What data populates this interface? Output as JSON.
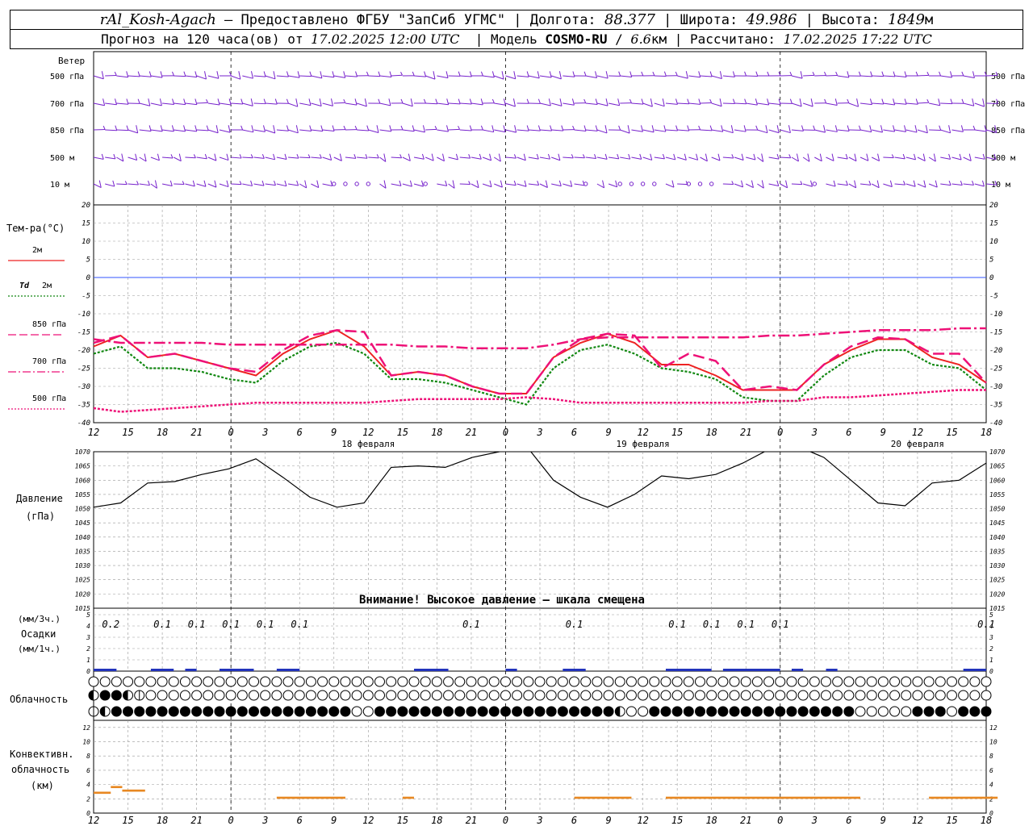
{
  "header": {
    "station": "rAl_Kosh-Agach",
    "sep": "–",
    "provider": "Предоставлено ФГБУ \"ЗапСиб УГМС\"",
    "lon_label": "Долгота:",
    "lon_value": "88.377",
    "lat_label": "Широта:",
    "lat_value": "49.986",
    "alt_label": "Высота:",
    "alt_value": "1849",
    "alt_unit": "м",
    "forecast_label": "Прогноз на 120 часа(ов) от",
    "forecast_from": "17.02.2025 12:00 UTC",
    "model_label": "Модель",
    "model_name": "COSMO-RU",
    "model_res": "6.6",
    "model_res_unit": "км",
    "calc_label": "Рассчитано:",
    "calc_time": "17.02.2025 17:22 UTC"
  },
  "labels": {
    "wind": "Ветер",
    "levels": [
      "500 гПа",
      "700 гПа",
      "850 гПа",
      "500 м",
      "10  м"
    ],
    "temp_title": "Тем-ра(°C)",
    "legend": [
      {
        "text": "2м",
        "prefix": "",
        "color": "#ee2222",
        "style": "solid"
      },
      {
        "text": "2м",
        "prefix": "Td",
        "color": "#118811",
        "style": "dotted"
      },
      {
        "text": "850 гПа",
        "prefix": "",
        "color": "#ee1177",
        "style": "longdash"
      },
      {
        "text": "700 гПа",
        "prefix": "",
        "color": "#ee1177",
        "style": "dashdot"
      },
      {
        "text": "500 гПа",
        "prefix": "",
        "color": "#ee1177",
        "style": "dotted"
      }
    ],
    "pressure_title": "Давление",
    "pressure_unit": "(гПа)",
    "pressure_warning": "Внимание! Высокое давление – шкала смещена",
    "precip_unit_3h": "(мм/3ч.)",
    "precip_title": "Осадки",
    "precip_unit_1h": "(мм/1ч.)",
    "cloud_title": "Облачность",
    "conv_title_1": "Конвективн.",
    "conv_title_2": "облачность",
    "conv_unit": "(км)",
    "dates": [
      "18 февраля",
      "19 февраля",
      "20 февраля"
    ]
  },
  "chart_data": [
    {
      "type": "line",
      "title": "Тем-ра(°C)",
      "x_hours_ticks": [
        "12",
        "15",
        "18",
        "21",
        "0",
        "3",
        "6",
        "9",
        "12",
        "15",
        "18",
        "21",
        "0",
        "3",
        "6",
        "9",
        "12",
        "15",
        "18",
        "21",
        "0",
        "3",
        "6",
        "9",
        "12",
        "15",
        "18"
      ],
      "ylim": [
        -40,
        20
      ],
      "yticks": [
        -40,
        -35,
        -30,
        -25,
        -20,
        -15,
        -10,
        -5,
        0,
        5,
        10,
        15,
        20
      ],
      "x_hours": [
        0,
        3,
        6,
        9,
        12,
        15,
        18,
        21,
        24,
        27,
        30,
        33,
        36,
        39,
        42,
        45,
        48,
        51,
        54,
        57,
        60,
        63,
        66,
        69,
        72,
        75,
        78
      ],
      "series": [
        {
          "name": "2м",
          "values": [
            -19,
            -16,
            -22,
            -21,
            -23,
            -25,
            -27,
            -21,
            -17,
            -14.5,
            -19,
            -27,
            -26,
            -27,
            -30,
            -32,
            -32,
            -22,
            -18,
            -15.5,
            -18,
            -24,
            -24,
            -27,
            -31,
            -31,
            -31,
            -24,
            -20,
            -17,
            -17,
            -22,
            -24,
            -29
          ]
        },
        {
          "name": "Td 2м",
          "values": [
            -21,
            -19,
            -25,
            -25,
            -26,
            -28,
            -29,
            -23,
            -19,
            -18,
            -21,
            -28,
            -28,
            -29,
            -31,
            -33,
            -35,
            -25,
            -20,
            -18.5,
            -21,
            -25,
            -26,
            -28,
            -33,
            -34,
            -34,
            -27,
            -22,
            -20,
            -20,
            -24,
            -25,
            -31
          ]
        },
        {
          "name": "850 гПа",
          "values": [
            -18,
            -16,
            -22,
            -21,
            -23,
            -25,
            -26,
            -20,
            -16,
            -14.5,
            -15,
            -27,
            -26,
            -27,
            -30,
            -32,
            -32,
            -22,
            -17,
            -15.5,
            -16,
            -25,
            -21,
            -23,
            -31,
            -30,
            -31,
            -24,
            -19,
            -16.5,
            -17,
            -21,
            -21,
            -29
          ]
        },
        {
          "name": "700 гПа",
          "values": [
            -17,
            -18,
            -18,
            -18,
            -18,
            -18.5,
            -18.5,
            -18.5,
            -18.5,
            -18.5,
            -18.5,
            -18.5,
            -19,
            -19,
            -19.5,
            -19.5,
            -19.5,
            -18.5,
            -17,
            -16.5,
            -16.5,
            -16.5,
            -16.5,
            -16.5,
            -16.5,
            -16,
            -16,
            -15.5,
            -15,
            -14.5,
            -14.5,
            -14.5,
            -14,
            -14
          ]
        },
        {
          "name": "500 гПа",
          "values": [
            -36,
            -37,
            -36.5,
            -36,
            -35.5,
            -35,
            -34.5,
            -34.5,
            -34.5,
            -34.5,
            -34.5,
            -34,
            -33.5,
            -33.5,
            -33.5,
            -33.5,
            -33,
            -33.5,
            -34.5,
            -34.5,
            -34.5,
            -34.5,
            -34.5,
            -34.5,
            -34.5,
            -34,
            -34,
            -33,
            -33,
            -32.5,
            -32,
            -31.5,
            -31,
            -31
          ]
        }
      ]
    },
    {
      "type": "line",
      "title": "Давление",
      "ylim": [
        1015,
        1070
      ],
      "yticks": [
        1015,
        1020,
        1025,
        1030,
        1035,
        1040,
        1045,
        1050,
        1055,
        1060,
        1065,
        1070
      ],
      "series": [
        {
          "name": "Давление",
          "values": [
            1050.5,
            1052,
            1059,
            1059.5,
            1062,
            1064,
            1067.5,
            1061,
            1054,
            1050.5,
            1052,
            1064.5,
            1065,
            1064.5,
            1068,
            1070,
            1072,
            1060,
            1054,
            1050.5,
            1055,
            1061.5,
            1060.5,
            1062,
            1066,
            1071,
            1072,
            1068,
            1060,
            1052,
            1051,
            1059,
            1060,
            1066
          ]
        }
      ]
    },
    {
      "type": "bar",
      "title": "Осадки",
      "ylim": [
        0,
        5
      ],
      "yticks": [
        0,
        1,
        2,
        3,
        4,
        5
      ],
      "labels_3h": [
        {
          "x": 1.5,
          "text": "0.2"
        },
        {
          "x": 6,
          "text": "0.1"
        },
        {
          "x": 9,
          "text": "0.1"
        },
        {
          "x": 12,
          "text": "0.1"
        },
        {
          "x": 15,
          "text": "0.1"
        },
        {
          "x": 18,
          "text": "0.1"
        },
        {
          "x": 33,
          "text": "0.1"
        },
        {
          "x": 42,
          "text": "0.1"
        },
        {
          "x": 51,
          "text": "0.1"
        },
        {
          "x": 54,
          "text": "0.1"
        },
        {
          "x": 57,
          "text": "0.1"
        },
        {
          "x": 60,
          "text": "0.1"
        },
        {
          "x": 78,
          "text": "0.1"
        }
      ],
      "values_1h": [
        0.15,
        0.15,
        0.05,
        0.05,
        0.05,
        0.05,
        0.05,
        0.05,
        0.05,
        0.05,
        0.05,
        0.05,
        0.05,
        0.05,
        0.05,
        0.05,
        0.05,
        0.05,
        0.05,
        0.05,
        0.05,
        0.05,
        0.05,
        0.05,
        0.05,
        0.05,
        0.05,
        0.05,
        0.05,
        0,
        0,
        0,
        0,
        0,
        0,
        0,
        0,
        0,
        0,
        0,
        0,
        0,
        0,
        0,
        0,
        0,
        0,
        0,
        0,
        0,
        0,
        0,
        0,
        0,
        0,
        0,
        0,
        0,
        0,
        0,
        0,
        0,
        0,
        0,
        0,
        0,
        0,
        0,
        0,
        0,
        0,
        0,
        0,
        0,
        0,
        0,
        0,
        0,
        0,
        0,
        0
      ]
    },
    {
      "type": "heatmap",
      "title": "Облачность",
      "rows": [
        "0000000000000000000000000000000000000000000000000000000000000000000000000000000",
        "2442100000000000000000000000000000000000000000000000000000000000000000000000000",
        "1244444444444444444444400444444444444444444444200444444444444444444000004440444"
      ]
    },
    {
      "type": "bar",
      "title": "Конвективн. облачность",
      "ylim": [
        0,
        13
      ],
      "yticks": [
        0,
        2,
        4,
        6,
        8,
        10,
        12
      ],
      "segments": [
        {
          "x0": 0,
          "x1": 1.5,
          "base": 2.7,
          "top": 3.0
        },
        {
          "x0": 1.5,
          "x1": 2.5,
          "base": 3.5,
          "top": 3.8
        },
        {
          "x0": 2.5,
          "x1": 4.5,
          "base": 3.0,
          "top": 3.3
        },
        {
          "x0": 16,
          "x1": 22,
          "base": 2.0,
          "top": 2.3
        },
        {
          "x0": 27,
          "x1": 28,
          "base": 2.0,
          "top": 2.3
        },
        {
          "x0": 42,
          "x1": 47,
          "base": 2.0,
          "top": 2.3
        },
        {
          "x0": 50,
          "x1": 67,
          "base": 2.0,
          "top": 2.3
        },
        {
          "x0": 73,
          "x1": 79,
          "base": 2.0,
          "top": 2.3
        }
      ]
    }
  ],
  "colors": {
    "wind": "#7722cc",
    "t2m": "#ee2222",
    "td2m": "#118811",
    "t850": "#ee1177",
    "t700": "#ee1177",
    "t500": "#ee1177",
    "zero_line": "#3355ff",
    "precip": "#2233bb",
    "conv": "#e88822",
    "grid": "#999999"
  }
}
